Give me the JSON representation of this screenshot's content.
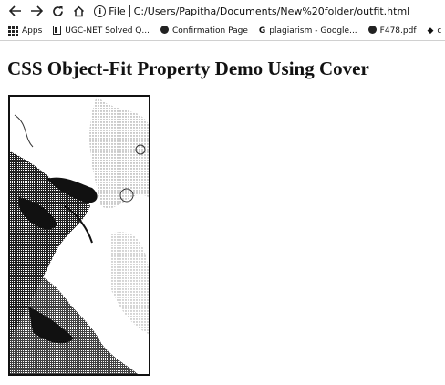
{
  "browser": {
    "scheme_label": "File",
    "url": "C:/Users/Papitha/Documents/New%20folder/outfit.html"
  },
  "bookmarks": {
    "items": [
      {
        "label": "Apps",
        "icon": "apps-grid-icon"
      },
      {
        "label": "UGC-NET Solved Q...",
        "icon": "bookmark-icon"
      },
      {
        "label": "Confirmation Page",
        "icon": "github-icon"
      },
      {
        "label": "plagiarism - Google...",
        "icon": "google-icon"
      },
      {
        "label": "F478.pdf",
        "icon": "github-icon"
      },
      {
        "label": "c",
        "icon": "diamond-icon"
      },
      {
        "label": "",
        "icon": "github-icon"
      }
    ]
  },
  "page": {
    "title": "CSS Object-Fit Property Demo Using Cover"
  }
}
